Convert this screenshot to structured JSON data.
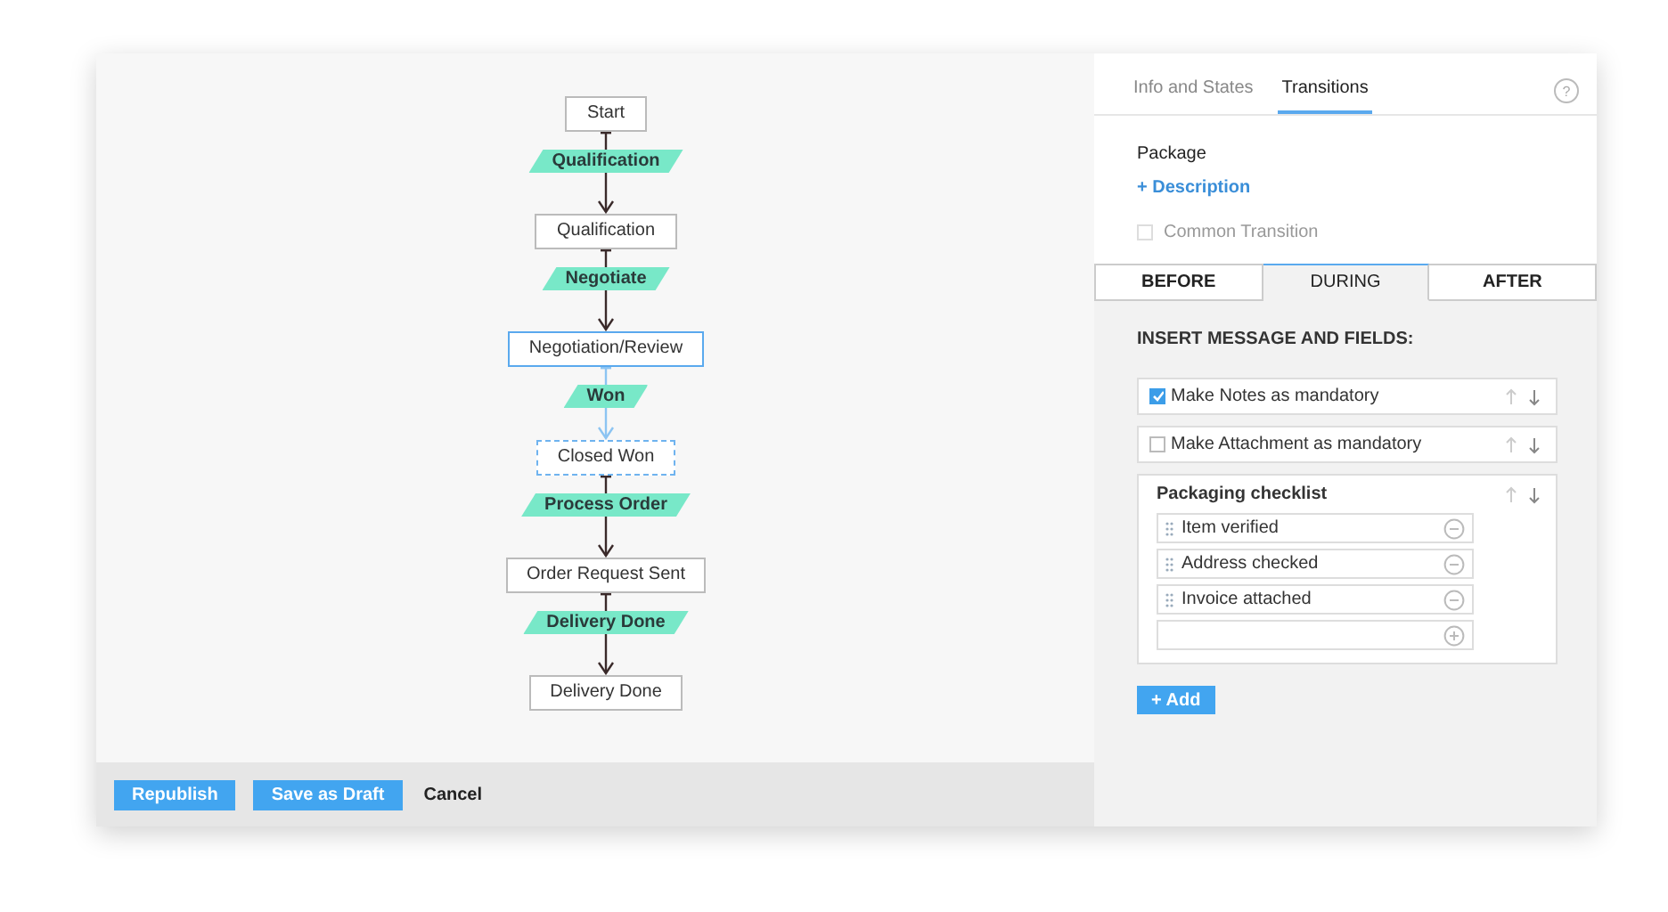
{
  "flow": {
    "states": [
      {
        "name": "Start",
        "selected": false,
        "target": false
      },
      {
        "name": "Qualification",
        "selected": false,
        "target": false
      },
      {
        "name": "Negotiation/Review",
        "selected": true,
        "target": false
      },
      {
        "name": "Closed Won",
        "selected": false,
        "target": true
      },
      {
        "name": "Order Request Sent",
        "selected": false,
        "target": false
      },
      {
        "name": "Delivery Done",
        "selected": false,
        "target": false
      }
    ],
    "transitions": [
      {
        "label": "Qualification",
        "selected": false
      },
      {
        "label": "Negotiate",
        "selected": false
      },
      {
        "label": "Won",
        "selected": true
      },
      {
        "label": "Process Order",
        "selected": false
      },
      {
        "label": "Delivery Done",
        "selected": false
      }
    ]
  },
  "footer": {
    "buttons": [
      {
        "label": "Republish",
        "kind": "primary"
      },
      {
        "label": "Save as Draft",
        "kind": "primary"
      },
      {
        "label": "Cancel",
        "kind": "link"
      }
    ]
  },
  "panel": {
    "tabs": [
      {
        "label": "Info and States",
        "selected": false
      },
      {
        "label": "Transitions",
        "selected": true
      }
    ],
    "help": "?",
    "transition_name": "Package",
    "description_link": "+ Description",
    "common_transition": {
      "label": "Common Transition",
      "checked": false
    },
    "phases": [
      {
        "label": "BEFORE",
        "selected": false
      },
      {
        "label": "DURING",
        "selected": true
      },
      {
        "label": "AFTER",
        "selected": false
      }
    ],
    "section_title": "INSERT MESSAGE AND FIELDS:",
    "fields": [
      {
        "kind": "checkbox",
        "label": "Make Notes as mandatory",
        "checked": true
      },
      {
        "kind": "checkbox",
        "label": "Make Attachment as mandatory",
        "checked": false
      },
      {
        "kind": "checklist",
        "title": "Packaging checklist",
        "items": [
          "Item verified",
          "Address checked",
          "Invoice attached"
        ]
      }
    ],
    "add_button": "+ Add"
  }
}
